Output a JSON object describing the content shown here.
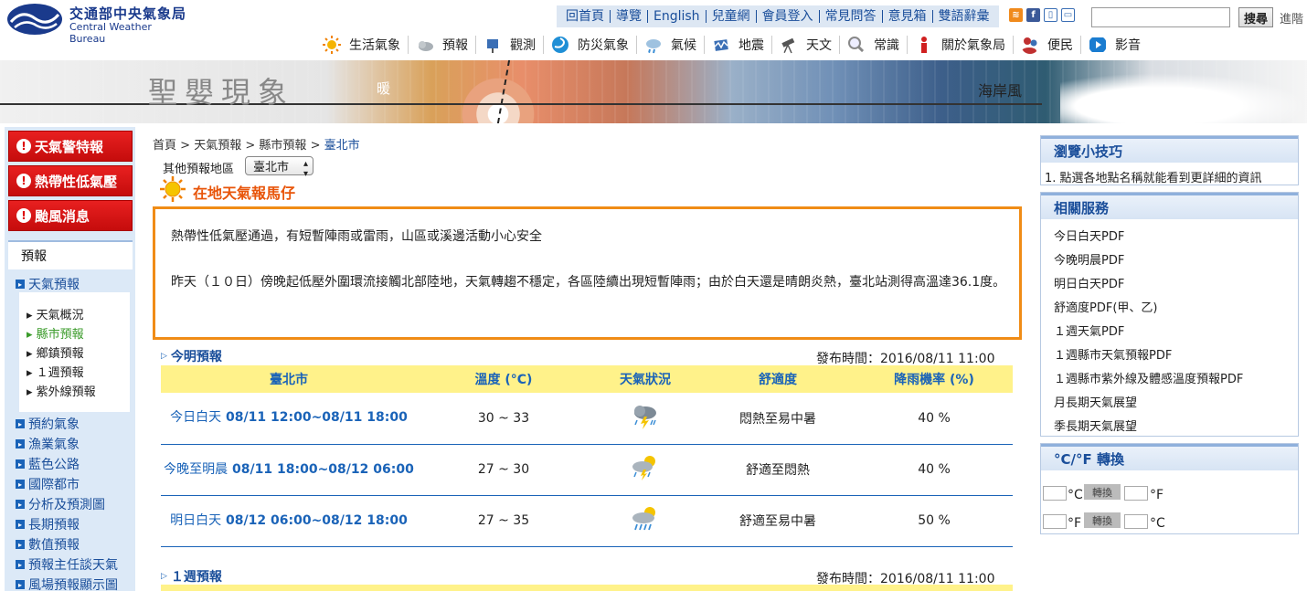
{
  "header": {
    "logo_zh": "交通部中央氣象局",
    "logo_en": "Central Weather Bureau",
    "top_links": [
      "回首頁",
      "導覽",
      "English",
      "兒童網",
      "會員登入",
      "常見問答",
      "意見箱",
      "雙語辭彙"
    ],
    "search_button": "搜尋",
    "advanced": "進階",
    "search_placeholder": ""
  },
  "main_nav": [
    {
      "label": "生活氣象",
      "icon": "sun-icon",
      "color": "#f0a000"
    },
    {
      "label": "預報",
      "icon": "cloud-icon",
      "color": "#9aa0a6"
    },
    {
      "label": "觀測",
      "icon": "observation-icon",
      "color": "#3b6fb5"
    },
    {
      "label": "防災氣象",
      "icon": "typhoon-icon",
      "color": "#1f8fd6"
    },
    {
      "label": "氣候",
      "icon": "climate-icon",
      "color": "#7aaed6"
    },
    {
      "label": "地震",
      "icon": "earthquake-icon",
      "color": "#3b6fb5"
    },
    {
      "label": "天文",
      "icon": "telescope-icon",
      "color": "#555555"
    },
    {
      "label": "常識",
      "icon": "magnifier-icon",
      "color": "#888888"
    },
    {
      "label": "關於氣象局",
      "icon": "info-icon",
      "color": "#d02020"
    },
    {
      "label": "便民",
      "icon": "people-icon",
      "color": "#c03030"
    },
    {
      "label": "影音",
      "icon": "play-icon",
      "color": "#1a7cd0"
    }
  ],
  "banner": {
    "title": "聖嬰現象",
    "warm_label": "暖",
    "coast_label": "海岸風"
  },
  "left": {
    "alerts": [
      "天氣警特報",
      "熱帶性低氣壓",
      "颱風消息"
    ],
    "forecast_head": "預報",
    "weather_forecast": "天氣預報",
    "sub_items": [
      "天氣概況",
      "縣市預報",
      "鄉鎮預報",
      "１週預報",
      "紫外線預報"
    ],
    "active_sub": 1,
    "more_items": [
      "預約氣象",
      "漁業氣象",
      "藍色公路",
      "國際都市",
      "分析及預測圖",
      "長期預報",
      "數值預報",
      "預報主任談天氣",
      "風場預報顯示圖"
    ]
  },
  "breadcrumb": {
    "items": [
      "首頁",
      "天氣預報",
      "縣市預報"
    ],
    "sep": ">",
    "current": "臺北市"
  },
  "region": {
    "label": "其他預報地區",
    "selected": "臺北市"
  },
  "local": {
    "title": "在地天氣報馬仔",
    "p1": "熱帶性低氣壓通過，有短暫陣雨或雷雨，山區或溪邊活動小心安全",
    "p2": "昨天（１０日）傍晚起低壓外圍環流接觸北部陸地，天氣轉趨不穩定，各區陸續出現短暫陣雨；由於白天還是晴朗炎熱，臺北站測得高溫達36.1度。"
  },
  "today": {
    "title": "今明預報",
    "pub_time": "發布時間：2016/08/11 11:00",
    "headers": [
      "臺北市",
      "溫度 (°C)",
      "天氣狀況",
      "舒適度",
      "降雨機率 (%)"
    ],
    "rows": [
      {
        "label": "今日白天",
        "period": "08/11 12:00~08/11 18:00",
        "temp": "30 ~ 33",
        "icon": "thunderstorm-icon",
        "comfort": "悶熱至易中暑",
        "rain": "40 %"
      },
      {
        "label": "今晚至明晨",
        "period": "08/11 18:00~08/12 06:00",
        "temp": "27 ~ 30",
        "icon": "partly-cloudy-thunder-icon",
        "comfort": "舒適至悶熱",
        "rain": "40 %"
      },
      {
        "label": "明日白天",
        "period": "08/12 06:00~08/12 18:00",
        "temp": "27 ~ 35",
        "icon": "partly-cloudy-rain-icon",
        "comfort": "舒適至易中暑",
        "rain": "50 %"
      }
    ]
  },
  "week": {
    "title": "１週預報",
    "pub_time": "發布時間：2016/08/11 11:00"
  },
  "right": {
    "tips_title": "瀏覽小技巧",
    "tips": [
      "1.  點選各地點名稱就能看到更詳細的資訊"
    ],
    "services_title": "相關服務",
    "services": [
      "今日白天PDF",
      "今晚明晨PDF",
      "明日白天PDF",
      "舒適度PDF(甲、乙)",
      "１週天氣PDF",
      "１週縣市天氣預報PDF",
      "１週縣市紫外線及體感溫度預報PDF",
      "月長期天氣展望",
      "季長期天氣展望"
    ],
    "conv_title": "°C/°F 轉換",
    "conv_btn": "轉換",
    "unit_c": "°C",
    "unit_f": "°F"
  },
  "colors": {
    "accent_blue": "#1a63b8",
    "alert_red": "#d01010",
    "highlight_orange": "#f08c16",
    "table_yellow": "#fff28a"
  }
}
